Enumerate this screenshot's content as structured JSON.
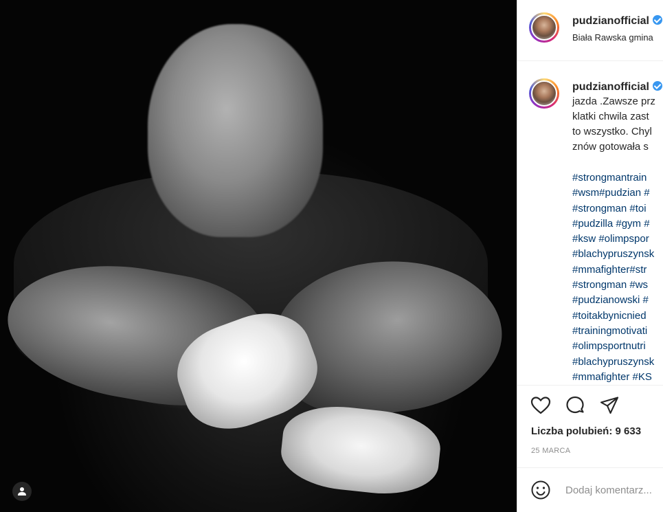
{
  "post": {
    "photo_alt": "",
    "user_tag_icon": "person-icon"
  },
  "header": {
    "username": "pudzianofficial",
    "location": "Biała Rawska gmina"
  },
  "caption": {
    "username": "pudzianofficial",
    "lines": [
      "jazda .Zawsze prz",
      "klatki chwila zast",
      "to wszystko. Chyl",
      "znów gotowała s"
    ],
    "hashtags": [
      "#strongmantrain",
      "#wsm#pudzian #",
      "#strongman #toi",
      "#pudzilla #gym #",
      "#ksw #olimpspor",
      "#blachypruszynsk",
      "#mmafighter#str",
      "#strongman #ws",
      "#pudzianowski #",
      "#toitakbynicnied",
      "#trainingmotivati",
      "#olimpsportnutri",
      "#blachypruszynsk",
      "#mmafighter #KS"
    ]
  },
  "actions": {
    "like_icon": "heart-icon",
    "comment_icon": "comment-icon",
    "share_icon": "send-icon"
  },
  "likes": {
    "text": "Liczba polubień: 9 633"
  },
  "date": "25 MARCA",
  "comment": {
    "emoji_icon": "smiley-icon",
    "placeholder": "Dodaj komentarz..."
  }
}
